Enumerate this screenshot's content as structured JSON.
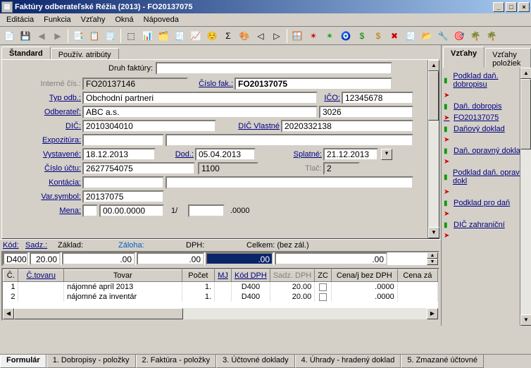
{
  "window": {
    "title": "Faktúry odberateľské  Réžia (2013) - FO20137075"
  },
  "menu": {
    "items": [
      "Editácia",
      "Funkcia",
      "Vzťahy",
      "Okná",
      "Nápoveda"
    ]
  },
  "tabs_left": {
    "standard": "Štandard",
    "user_attr": "Použív. atribúty"
  },
  "tabs_right": {
    "relations": "Vzťahy",
    "item_relations": "Vzťahy položiek"
  },
  "form": {
    "druh_label": "Druh faktúry:",
    "druh": "",
    "interne_label": "Interné čís.:",
    "interne": "FO20137146",
    "cislo_fak_label": "Číslo fak.:",
    "cislo_fak": "FO20137075",
    "typ_odb_label": "Typ odb.:",
    "typ_odb": "Obchodní partneri",
    "ico_label": "IČO:",
    "ico": "12345678",
    "odberatel_label": "Odberateľ:",
    "odberatel": "ABC a.s.",
    "odberatel_kod": "3026",
    "dic_label": "DIČ:",
    "dic": "2010304010",
    "dic_vlastne_label": "DIČ Vlastné",
    "dic_vlastne": "2020332138",
    "expozitura_label": "Expozitúra:",
    "expozitura": "",
    "expozitura2": "",
    "vystavene_label": "Vystavené:",
    "vystavene": "18.12.2013",
    "dod_label": "Dod.:",
    "dod": "05.04.2013",
    "splatne_label": "Splatné:",
    "splatne": "21.12.2013",
    "cislo_uctu_label": "Číslo účtu:",
    "cislo_uctu": "2627754075",
    "cislo_uctu2": "1100",
    "tlac_label": "Tlač:",
    "tlac": "2",
    "kontacia_label": "Kontácia:",
    "kontacia": "",
    "varsymbol_label": "Var.symbol:",
    "varsymbol": "20137075",
    "mena_label": "Mena:",
    "mena_kod": "",
    "mena_datum": "00.00.0000",
    "mena_num1": "1/",
    "mena_num2": "",
    "mena_num3": ".0000"
  },
  "summary": {
    "kod_label": "Kód:",
    "sadz_label": "Sadz.:",
    "zaklad_label": "Základ:",
    "zaloha_label": "Záloha:",
    "dph_label": "DPH:",
    "celkem_label": "Celkem: (bez zál.)",
    "kod": "D400",
    "sadz": "20.00",
    "zaklad": ".00",
    "zaloha": ".00",
    "dph": ".00",
    "celkem": ".00"
  },
  "grid": {
    "headers": {
      "c": "Č.",
      "ctovaru": "Č.tovaru",
      "tovar": "Tovar",
      "pocet": "Počet",
      "mj": "MJ",
      "kod_dph": "Kód DPH",
      "sadz_dph": "Sadz. DPH",
      "zc": "ZC",
      "cenaj": "Cena/j bez DPH",
      "cenaza": "Cena zá"
    },
    "rows": [
      {
        "c": "1",
        "ctovaru": "",
        "tovar": "nájomné apríl 2013",
        "pocet": "1.",
        "mj": "",
        "kod_dph": "D400",
        "sadz": "20.00",
        "zc": "",
        "cenaj": ".0000"
      },
      {
        "c": "2",
        "ctovaru": "",
        "tovar": "nájomné za inventár",
        "pocet": "1.",
        "mj": "",
        "kod_dph": "D400",
        "sadz": "20.00",
        "zc": "",
        "cenaj": ".0000"
      }
    ]
  },
  "bottom_tabs": {
    "formular": "Formulár",
    "t1": "1. Dobropisy - položky",
    "t2": "2. Faktúra - položky",
    "t3": "3. Účtovné doklady",
    "t4": "4. Úhrady - hradený doklad",
    "t5": "5. Zmazané účtovné"
  },
  "relations": [
    {
      "t": "Podklad daň. dobropisu",
      "g": true
    },
    {
      "t": "",
      "g": false,
      "noline": true
    },
    {
      "t": "Daň. dobropis",
      "g": true
    },
    {
      "t": "FO20137075",
      "g": false
    },
    {
      "t": "Daňový doklad",
      "g": true
    },
    {
      "t": "",
      "g": false,
      "noline": true
    },
    {
      "t": "Daň. opravný doklad",
      "g": true
    },
    {
      "t": "",
      "g": false,
      "noline": true
    },
    {
      "t": "Podklad daň. oprav. dokl",
      "g": true
    },
    {
      "t": "",
      "g": false,
      "noline": true
    },
    {
      "t": "Podklad pro daň",
      "g": true
    },
    {
      "t": "",
      "g": false,
      "noline": true
    },
    {
      "t": "DIČ zahraniční",
      "g": true
    },
    {
      "t": "",
      "g": false,
      "noline": true
    }
  ]
}
